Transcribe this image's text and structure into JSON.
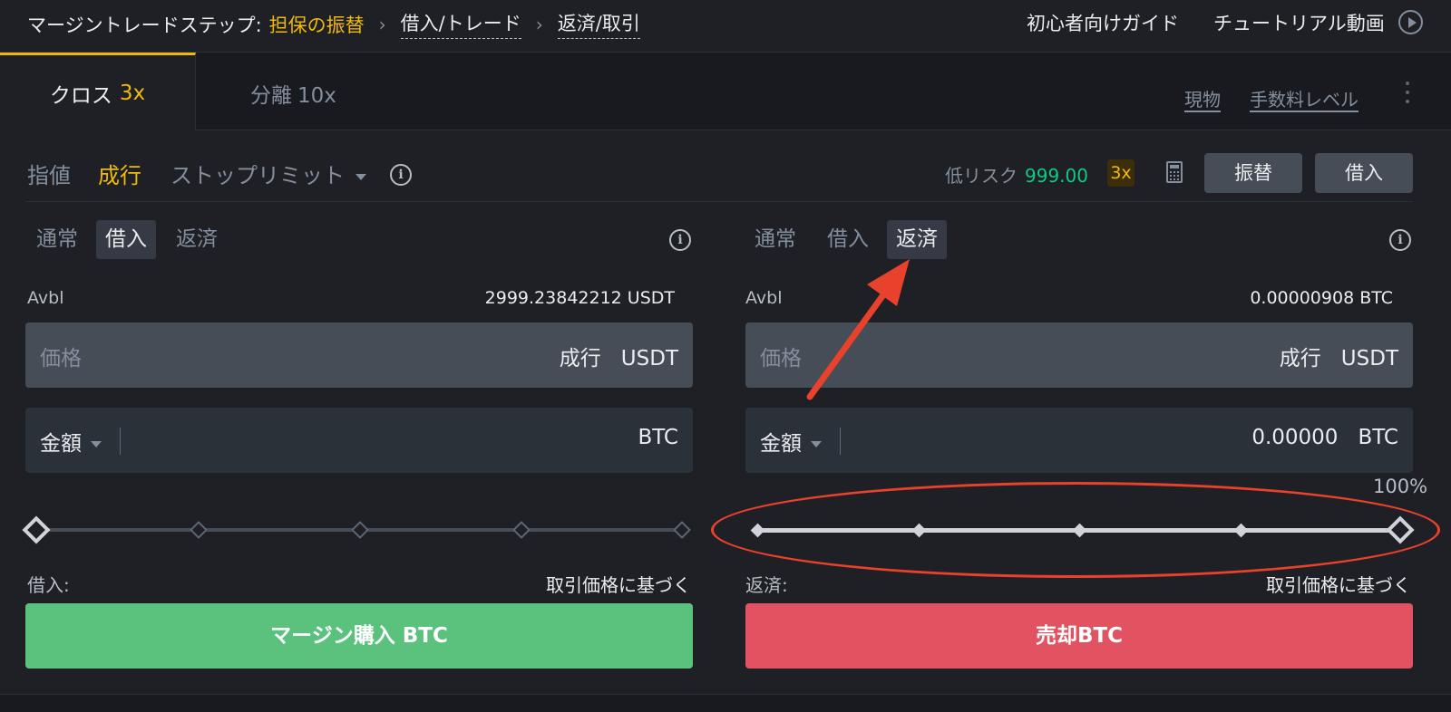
{
  "steps": {
    "label": "マージントレードステップ:",
    "items": [
      "担保の振替",
      "借入/トレード",
      "返済/取引"
    ]
  },
  "header_links": {
    "guide": "初心者向けガイド",
    "video": "チュートリアル動画"
  },
  "mode_tabs": [
    {
      "label": "クロス",
      "leverage": "3x",
      "active": true
    },
    {
      "label": "分離",
      "leverage": "10x",
      "active": false
    }
  ],
  "mode_links": {
    "spot": "現物",
    "fee": "手数料レベル"
  },
  "order_types": {
    "limit": "指値",
    "market": "成行",
    "stop": "ストップリミット",
    "active": "market"
  },
  "risk": {
    "label": "低リスク",
    "value": "999.00",
    "leverage": "3x"
  },
  "actions": {
    "transfer": "振替",
    "borrow": "借入"
  },
  "buy_panel": {
    "tabs": [
      "通常",
      "借入",
      "返済"
    ],
    "selected_tab": "借入",
    "avbl_label": "Avbl",
    "avbl_value": "2999.23842212 USDT",
    "price_placeholder": "価格",
    "price_type": "成行",
    "price_unit": "USDT",
    "amount_label": "金額",
    "amount_value": "",
    "amount_unit": "BTC",
    "slider_percent": 0,
    "note_label": "借入:",
    "note_value": "取引価格に基づく",
    "button": "マージン購入 BTC",
    "button_color": "#5bc27e"
  },
  "sell_panel": {
    "tabs": [
      "通常",
      "借入",
      "返済"
    ],
    "selected_tab": "返済",
    "avbl_label": "Avbl",
    "avbl_value": "0.00000908 BTC",
    "price_placeholder": "価格",
    "price_type": "成行",
    "price_unit": "USDT",
    "amount_label": "金額",
    "amount_value": "0.00000",
    "amount_unit": "BTC",
    "slider_percent": 100,
    "slider_label": "100%",
    "note_label": "返済:",
    "note_value": "取引価格に基づく",
    "button": "売却BTC",
    "button_color": "#e35260"
  },
  "colors": {
    "accent": "#f0b90b",
    "positive": "#0ecb81",
    "annotation": "#e8412c"
  },
  "icons": [
    "chevron-right-icon",
    "play-circle-icon",
    "kebab-menu-icon",
    "info-icon",
    "calculator-icon",
    "caret-down-icon"
  ]
}
